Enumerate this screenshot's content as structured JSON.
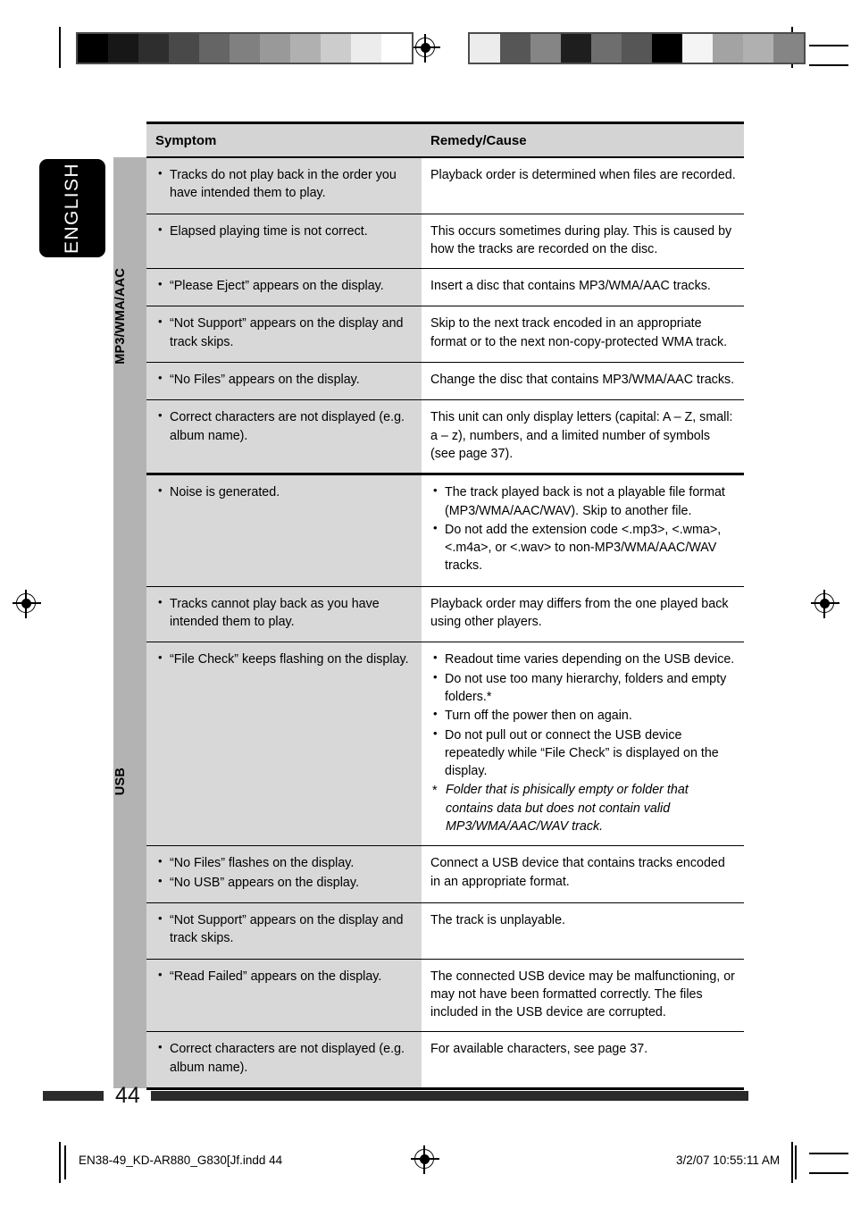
{
  "page": {
    "language_tab": "ENGLISH",
    "page_number": "44"
  },
  "table": {
    "headers": {
      "symptom": "Symptom",
      "remedy": "Remedy/Cause"
    },
    "sections": [
      {
        "category": "MP3/WMA/AAC",
        "rows": [
          {
            "symptom_bullets": [
              "Tracks do not play back in the order you have intended them to play."
            ],
            "remedy_lines": [
              "Playback order is determined when files are recorded."
            ]
          },
          {
            "symptom_bullets": [
              "Elapsed playing time is not correct."
            ],
            "remedy_lines": [
              "This occurs sometimes during play. This is caused by how the tracks are recorded on the disc."
            ]
          },
          {
            "symptom_bullets": [
              "“Please Eject” appears on the display."
            ],
            "remedy_lines": [
              "Insert a disc that contains MP3/WMA/AAC tracks."
            ]
          },
          {
            "symptom_bullets": [
              "“Not Support” appears on the display and track skips."
            ],
            "remedy_lines": [
              "Skip to the next track encoded in an appropriate format or to the next non-copy-protected WMA track."
            ]
          },
          {
            "symptom_bullets": [
              "“No Files” appears on the display."
            ],
            "remedy_lines": [
              "Change the disc that contains MP3/WMA/AAC tracks."
            ]
          },
          {
            "symptom_bullets": [
              "Correct characters are not displayed (e.g. album name)."
            ],
            "remedy_lines": [
              "This unit can only display letters (capital: A – Z, small: a – z), numbers, and a limited number of symbols (see page 37)."
            ]
          }
        ]
      },
      {
        "category": "USB",
        "rows": [
          {
            "symptom_bullets": [
              "Noise is generated."
            ],
            "remedy_bullets": [
              "The track played back is not a playable file format (MP3/WMA/AAC/WAV). Skip to another file.",
              "Do not add the extension code <.mp3>, <.wma>, <.m4a>, or <.wav> to non-MP3/WMA/AAC/WAV tracks."
            ]
          },
          {
            "symptom_bullets": [
              "Tracks cannot play back as you have intended them to play."
            ],
            "remedy_lines": [
              "Playback order may differs from the one played back using other players."
            ]
          },
          {
            "symptom_bullets": [
              "“File Check” keeps flashing on the display."
            ],
            "remedy_bullets": [
              "Readout time varies depending on the USB device.",
              "Do not use too many hierarchy, folders and empty folders.*",
              "Turn off the power then on again.",
              "Do not pull out or connect the USB device repeatedly while “File Check” is displayed on the display."
            ],
            "remedy_footnote": "Folder that is phisically empty or folder that contains data but does not contain valid MP3/WMA/AAC/WAV track."
          },
          {
            "symptom_bullets": [
              "“No Files” flashes on the display.",
              "“No USB” appears on the display."
            ],
            "remedy_lines": [
              "Connect a USB device that contains tracks encoded in an appropriate format."
            ]
          },
          {
            "symptom_bullets": [
              "“Not Support” appears on the display and track skips."
            ],
            "remedy_lines": [
              "The track is unplayable."
            ]
          },
          {
            "symptom_bullets": [
              "“Read Failed” appears on the display."
            ],
            "remedy_lines": [
              "The connected USB device may be malfunctioning, or may not have been formatted correctly. The files included in the USB device are corrupted."
            ]
          },
          {
            "symptom_bullets": [
              "Correct characters are not displayed (e.g. album name)."
            ],
            "remedy_lines": [
              "For available characters, see page 37."
            ]
          }
        ]
      }
    ]
  },
  "imposition": {
    "file_name": "EN38-49_KD-AR880_G830[Jf.indd   44",
    "timestamp": "3/2/07   10:55:11 AM"
  },
  "print_marks": {
    "left_wedge": [
      "#000000",
      "#171717",
      "#2e2e2e",
      "#494949",
      "#656565",
      "#808080",
      "#999999",
      "#b0b0b0",
      "#cccccc",
      "#ececec",
      "#ffffff"
    ],
    "right_wedge": [
      "#ececec",
      "#565656",
      "#858585",
      "#1e1e1e",
      "#6e6e6e",
      "#565656",
      "#000000",
      "#f4f4f4",
      "#a3a3a3",
      "#b0b0b0",
      "#858585"
    ]
  }
}
